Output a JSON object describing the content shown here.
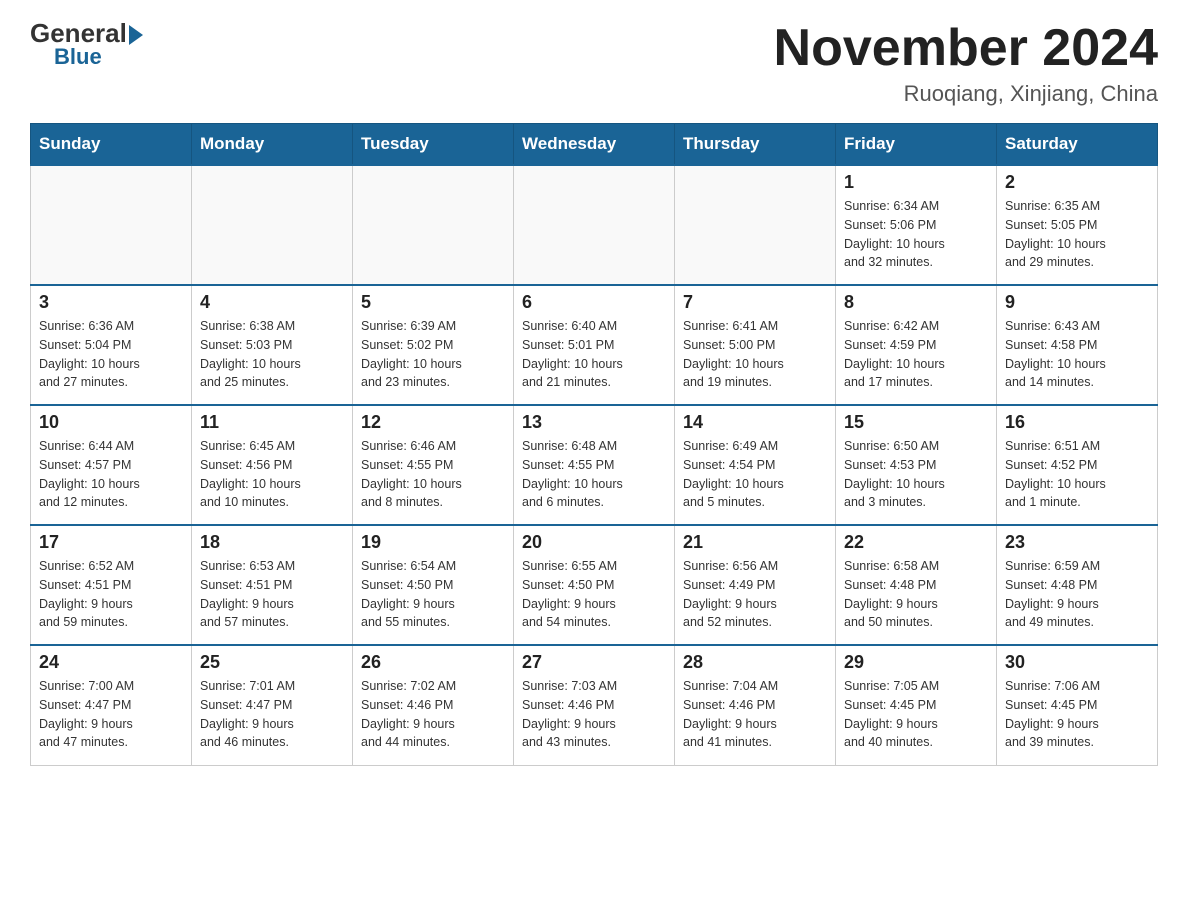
{
  "header": {
    "logo_line1": "General",
    "logo_line2": "Blue",
    "month_title": "November 2024",
    "location": "Ruoqiang, Xinjiang, China"
  },
  "weekdays": [
    "Sunday",
    "Monday",
    "Tuesday",
    "Wednesday",
    "Thursday",
    "Friday",
    "Saturday"
  ],
  "weeks": [
    [
      {
        "day": "",
        "info": ""
      },
      {
        "day": "",
        "info": ""
      },
      {
        "day": "",
        "info": ""
      },
      {
        "day": "",
        "info": ""
      },
      {
        "day": "",
        "info": ""
      },
      {
        "day": "1",
        "info": "Sunrise: 6:34 AM\nSunset: 5:06 PM\nDaylight: 10 hours\nand 32 minutes."
      },
      {
        "day": "2",
        "info": "Sunrise: 6:35 AM\nSunset: 5:05 PM\nDaylight: 10 hours\nand 29 minutes."
      }
    ],
    [
      {
        "day": "3",
        "info": "Sunrise: 6:36 AM\nSunset: 5:04 PM\nDaylight: 10 hours\nand 27 minutes."
      },
      {
        "day": "4",
        "info": "Sunrise: 6:38 AM\nSunset: 5:03 PM\nDaylight: 10 hours\nand 25 minutes."
      },
      {
        "day": "5",
        "info": "Sunrise: 6:39 AM\nSunset: 5:02 PM\nDaylight: 10 hours\nand 23 minutes."
      },
      {
        "day": "6",
        "info": "Sunrise: 6:40 AM\nSunset: 5:01 PM\nDaylight: 10 hours\nand 21 minutes."
      },
      {
        "day": "7",
        "info": "Sunrise: 6:41 AM\nSunset: 5:00 PM\nDaylight: 10 hours\nand 19 minutes."
      },
      {
        "day": "8",
        "info": "Sunrise: 6:42 AM\nSunset: 4:59 PM\nDaylight: 10 hours\nand 17 minutes."
      },
      {
        "day": "9",
        "info": "Sunrise: 6:43 AM\nSunset: 4:58 PM\nDaylight: 10 hours\nand 14 minutes."
      }
    ],
    [
      {
        "day": "10",
        "info": "Sunrise: 6:44 AM\nSunset: 4:57 PM\nDaylight: 10 hours\nand 12 minutes."
      },
      {
        "day": "11",
        "info": "Sunrise: 6:45 AM\nSunset: 4:56 PM\nDaylight: 10 hours\nand 10 minutes."
      },
      {
        "day": "12",
        "info": "Sunrise: 6:46 AM\nSunset: 4:55 PM\nDaylight: 10 hours\nand 8 minutes."
      },
      {
        "day": "13",
        "info": "Sunrise: 6:48 AM\nSunset: 4:55 PM\nDaylight: 10 hours\nand 6 minutes."
      },
      {
        "day": "14",
        "info": "Sunrise: 6:49 AM\nSunset: 4:54 PM\nDaylight: 10 hours\nand 5 minutes."
      },
      {
        "day": "15",
        "info": "Sunrise: 6:50 AM\nSunset: 4:53 PM\nDaylight: 10 hours\nand 3 minutes."
      },
      {
        "day": "16",
        "info": "Sunrise: 6:51 AM\nSunset: 4:52 PM\nDaylight: 10 hours\nand 1 minute."
      }
    ],
    [
      {
        "day": "17",
        "info": "Sunrise: 6:52 AM\nSunset: 4:51 PM\nDaylight: 9 hours\nand 59 minutes."
      },
      {
        "day": "18",
        "info": "Sunrise: 6:53 AM\nSunset: 4:51 PM\nDaylight: 9 hours\nand 57 minutes."
      },
      {
        "day": "19",
        "info": "Sunrise: 6:54 AM\nSunset: 4:50 PM\nDaylight: 9 hours\nand 55 minutes."
      },
      {
        "day": "20",
        "info": "Sunrise: 6:55 AM\nSunset: 4:50 PM\nDaylight: 9 hours\nand 54 minutes."
      },
      {
        "day": "21",
        "info": "Sunrise: 6:56 AM\nSunset: 4:49 PM\nDaylight: 9 hours\nand 52 minutes."
      },
      {
        "day": "22",
        "info": "Sunrise: 6:58 AM\nSunset: 4:48 PM\nDaylight: 9 hours\nand 50 minutes."
      },
      {
        "day": "23",
        "info": "Sunrise: 6:59 AM\nSunset: 4:48 PM\nDaylight: 9 hours\nand 49 minutes."
      }
    ],
    [
      {
        "day": "24",
        "info": "Sunrise: 7:00 AM\nSunset: 4:47 PM\nDaylight: 9 hours\nand 47 minutes."
      },
      {
        "day": "25",
        "info": "Sunrise: 7:01 AM\nSunset: 4:47 PM\nDaylight: 9 hours\nand 46 minutes."
      },
      {
        "day": "26",
        "info": "Sunrise: 7:02 AM\nSunset: 4:46 PM\nDaylight: 9 hours\nand 44 minutes."
      },
      {
        "day": "27",
        "info": "Sunrise: 7:03 AM\nSunset: 4:46 PM\nDaylight: 9 hours\nand 43 minutes."
      },
      {
        "day": "28",
        "info": "Sunrise: 7:04 AM\nSunset: 4:46 PM\nDaylight: 9 hours\nand 41 minutes."
      },
      {
        "day": "29",
        "info": "Sunrise: 7:05 AM\nSunset: 4:45 PM\nDaylight: 9 hours\nand 40 minutes."
      },
      {
        "day": "30",
        "info": "Sunrise: 7:06 AM\nSunset: 4:45 PM\nDaylight: 9 hours\nand 39 minutes."
      }
    ]
  ]
}
